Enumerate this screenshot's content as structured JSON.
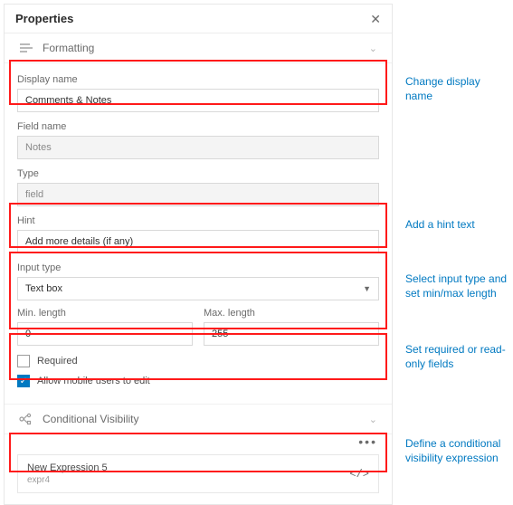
{
  "panel": {
    "title": "Properties",
    "sections": {
      "formatting": "Formatting",
      "conditional": "Conditional Visibility"
    },
    "fields": {
      "display_name": {
        "label": "Display name",
        "value": "Comments & Notes"
      },
      "field_name": {
        "label": "Field name",
        "value": "Notes"
      },
      "type": {
        "label": "Type",
        "value": "field"
      },
      "hint": {
        "label": "Hint",
        "value": "Add more details (if any)"
      },
      "input_type": {
        "label": "Input type",
        "value": "Text box"
      },
      "min_len": {
        "label": "Min. length",
        "value": "0"
      },
      "max_len": {
        "label": "Max. length",
        "value": "255"
      },
      "required": {
        "label": "Required",
        "checked": false
      },
      "allow_mobile": {
        "label": "Allow mobile users to edit",
        "checked": true
      }
    },
    "expression": {
      "name": "New Expression 5",
      "id": "expr4"
    }
  },
  "annotations": {
    "a1": "Change display name",
    "a2": "Add a hint text",
    "a3": "Select input type and set min/max length",
    "a4": "Set required or read-only fields",
    "a5": "Define a conditional visibility expression"
  }
}
